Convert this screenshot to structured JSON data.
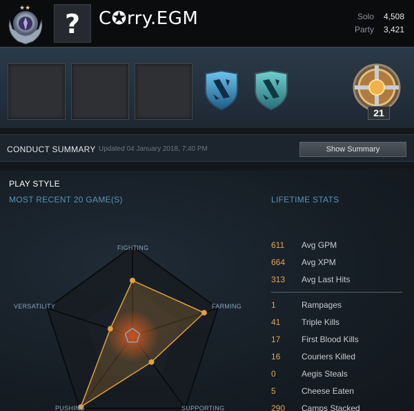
{
  "header": {
    "avatar_placeholder": "?",
    "player_name": "C✪rry.EGM",
    "mmr": [
      {
        "label": "Solo",
        "value": "4,508"
      },
      {
        "label": "Party",
        "value": "3,421"
      }
    ]
  },
  "showcase": {
    "hero_slots": 3,
    "level": "21"
  },
  "conduct": {
    "title": "CONDUCT SUMMARY",
    "updated": "Updated 04 January 2018, 7:40 PM",
    "button": "Show Summary"
  },
  "playstyle": {
    "title": "PLAY STYLE",
    "subtitle": "MOST RECENT 20 GAME(S)",
    "axes": {
      "fighting": "FIGHTING",
      "farming": "FARMING",
      "supporting": "SUPPORTING",
      "pushing": "PUSHING",
      "versatility": "VERSATILITY"
    },
    "scores": {
      "fighting": 0.62,
      "farming": 0.84,
      "supporting": 0.36,
      "pushing": 0.98,
      "versatility": 0.26
    },
    "colors": {
      "fill": "#e2a040",
      "glow": "#d2461e"
    }
  },
  "lifetime": {
    "title": "LIFETIME STATS",
    "averages": [
      {
        "value": "611",
        "label": "Avg GPM"
      },
      {
        "value": "664",
        "label": "Avg XPM"
      },
      {
        "value": "313",
        "label": "Avg Last Hits"
      }
    ],
    "totals": [
      {
        "value": "1",
        "label": "Rampages"
      },
      {
        "value": "41",
        "label": "Triple Kills"
      },
      {
        "value": "17",
        "label": "First Blood Kills"
      },
      {
        "value": "16",
        "label": "Couriers Killed"
      },
      {
        "value": "0",
        "label": "Aegis Steals"
      },
      {
        "value": "5",
        "label": "Cheese Eaten"
      },
      {
        "value": "290",
        "label": "Camps Stacked"
      }
    ]
  }
}
